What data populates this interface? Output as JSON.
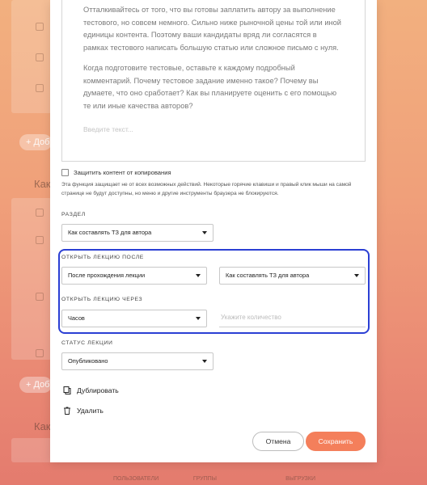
{
  "background": {
    "titles": [
      "Как",
      "Как"
    ],
    "add_pill": "+ Доб",
    "nav": [
      "ПОЛЬЗОВАТЕЛИ",
      "ГРУППЫ",
      "",
      "ВЫГРУЗКИ"
    ]
  },
  "editor": {
    "paragraphs": [
      "Отталкивайтесь от того, что вы готовы заплатить автору за выполнение тестового, но совсем немного. Сильно ниже рыночной цены той или иной единицы контента. Поэтому ваши кандидаты вряд ли согласятся в рамках тестового написать большую статью или сложное письмо с нуля.",
      "Когда подготовите тестовые, оставьте к каждому подробный комментарий. Почему тестовое задание именно такое? Почему вы думаете, что оно сработает? Как вы планируете оценить с его помощью те или иные качества авторов?"
    ],
    "placeholder": "Введите текст..."
  },
  "protect": {
    "label": "Защитить контент от копирования",
    "hint": "Эта функция защищает не от всех возможных действий. Некоторые горячие клавиши и правый клик мыши на самой странице не будут доступны, но меню и другие инструменты браузера не блокируются."
  },
  "section": {
    "label": "РАЗДЕЛ",
    "value": "Как составлять ТЗ для автора"
  },
  "open_after": {
    "label": "ОТКРЫТЬ ЛЕКЦИЮ ПОСЛЕ",
    "condition": "После прохождения лекции",
    "lecture": "Как составлять ТЗ для автора"
  },
  "open_in": {
    "label": "ОТКРЫТЬ ЛЕКЦИЮ ЧЕРЕЗ",
    "unit": "Часов",
    "amount_placeholder": "Укажите количество"
  },
  "status": {
    "label": "СТАТУС ЛЕКЦИИ",
    "value": "Опубликовано"
  },
  "actions": {
    "duplicate": "Дублировать",
    "delete": "Удалить"
  },
  "buttons": {
    "cancel": "Отмена",
    "save": "Сохранить"
  },
  "colors": {
    "accent": "#f47f5b",
    "highlight": "#2b3fd4"
  }
}
